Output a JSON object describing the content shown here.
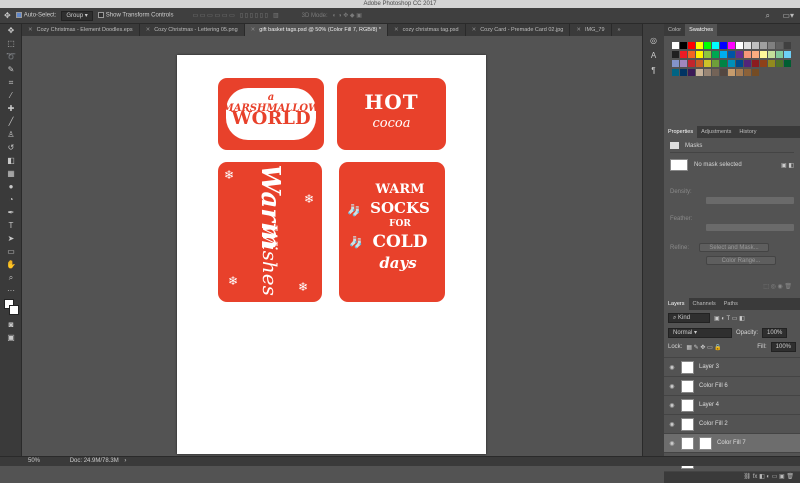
{
  "app": {
    "title": "Adobe Photoshop CC 2017"
  },
  "options_bar": {
    "auto_select_label": "Auto-Select:",
    "auto_select_value": "Group",
    "show_transform_label": "Show Transform Controls",
    "mode_3d_label": "3D Mode:"
  },
  "tabs": [
    {
      "label": "Cozy Christmas - Element Doodles.eps"
    },
    {
      "label": "Cozy Christmas - Lettering 05.png"
    },
    {
      "label": "gift basket tags.psd @ 50% (Color Fill 7, RGB/8) *"
    },
    {
      "label": "cozy christmas tag.psd"
    },
    {
      "label": "Cozy Card - Premade Card 02.jpg"
    },
    {
      "label": "IMG_79"
    }
  ],
  "cards": [
    {
      "lines": [
        "a MARSHMALLOW",
        "WORLD"
      ]
    },
    {
      "lines": [
        "HOT",
        "cocoa"
      ]
    },
    {
      "lines": [
        "Warm",
        "Wishes"
      ]
    },
    {
      "lines": [
        "WARM",
        "SOCKS",
        "FOR",
        "COLD",
        "days"
      ]
    }
  ],
  "colors": {
    "card_red": "#e8412b",
    "panel_bg": "#535353",
    "toolbar_bg": "#3a3a3a",
    "accent_blue": "#5f86c9"
  },
  "swatches_panel": {
    "tabs": [
      "Color",
      "Swatches"
    ],
    "active": "Swatches"
  },
  "properties_panel": {
    "tabs": [
      "Properties",
      "Adjustments",
      "History"
    ],
    "header": "Masks",
    "mask_status": "No mask selected",
    "density_label": "Density:",
    "feather_label": "Feather:",
    "refine_label": "Refine:",
    "select_mask_label": "Select and Mask...",
    "color_range_label": "Color Range..."
  },
  "layers_panel": {
    "tabs": [
      "Layers",
      "Channels",
      "Paths"
    ],
    "filter": "Kind",
    "blend_mode": "Normal",
    "opacity_label": "Opacity:",
    "opacity_value": "100%",
    "lock_label": "Lock:",
    "fill_label": "Fill:",
    "fill_value": "100%",
    "layers": [
      {
        "name": "Layer 3",
        "active": false
      },
      {
        "name": "Color Fill 6",
        "active": false
      },
      {
        "name": "Layer 4",
        "active": false
      },
      {
        "name": "Color Fill 2",
        "active": false
      },
      {
        "name": "Color Fill 7",
        "active": true
      },
      {
        "name": "Layer 5",
        "active": false
      }
    ]
  },
  "status": {
    "zoom": "50%",
    "doc": "Doc: 24.9M/78.3M"
  },
  "icons": {
    "tools": [
      "move-tool-icon",
      "marquee-tool-icon",
      "lasso-tool-icon",
      "quick-select-tool-icon",
      "crop-tool-icon",
      "eyedropper-tool-icon",
      "healing-brush-icon",
      "brush-tool-icon",
      "clone-stamp-icon",
      "history-brush-icon",
      "eraser-tool-icon",
      "gradient-tool-icon",
      "blur-tool-icon",
      "dodge-tool-icon",
      "pen-tool-icon",
      "type-tool-icon",
      "path-select-icon",
      "rectangle-tool-icon",
      "hand-tool-icon",
      "zoom-tool-icon"
    ]
  }
}
